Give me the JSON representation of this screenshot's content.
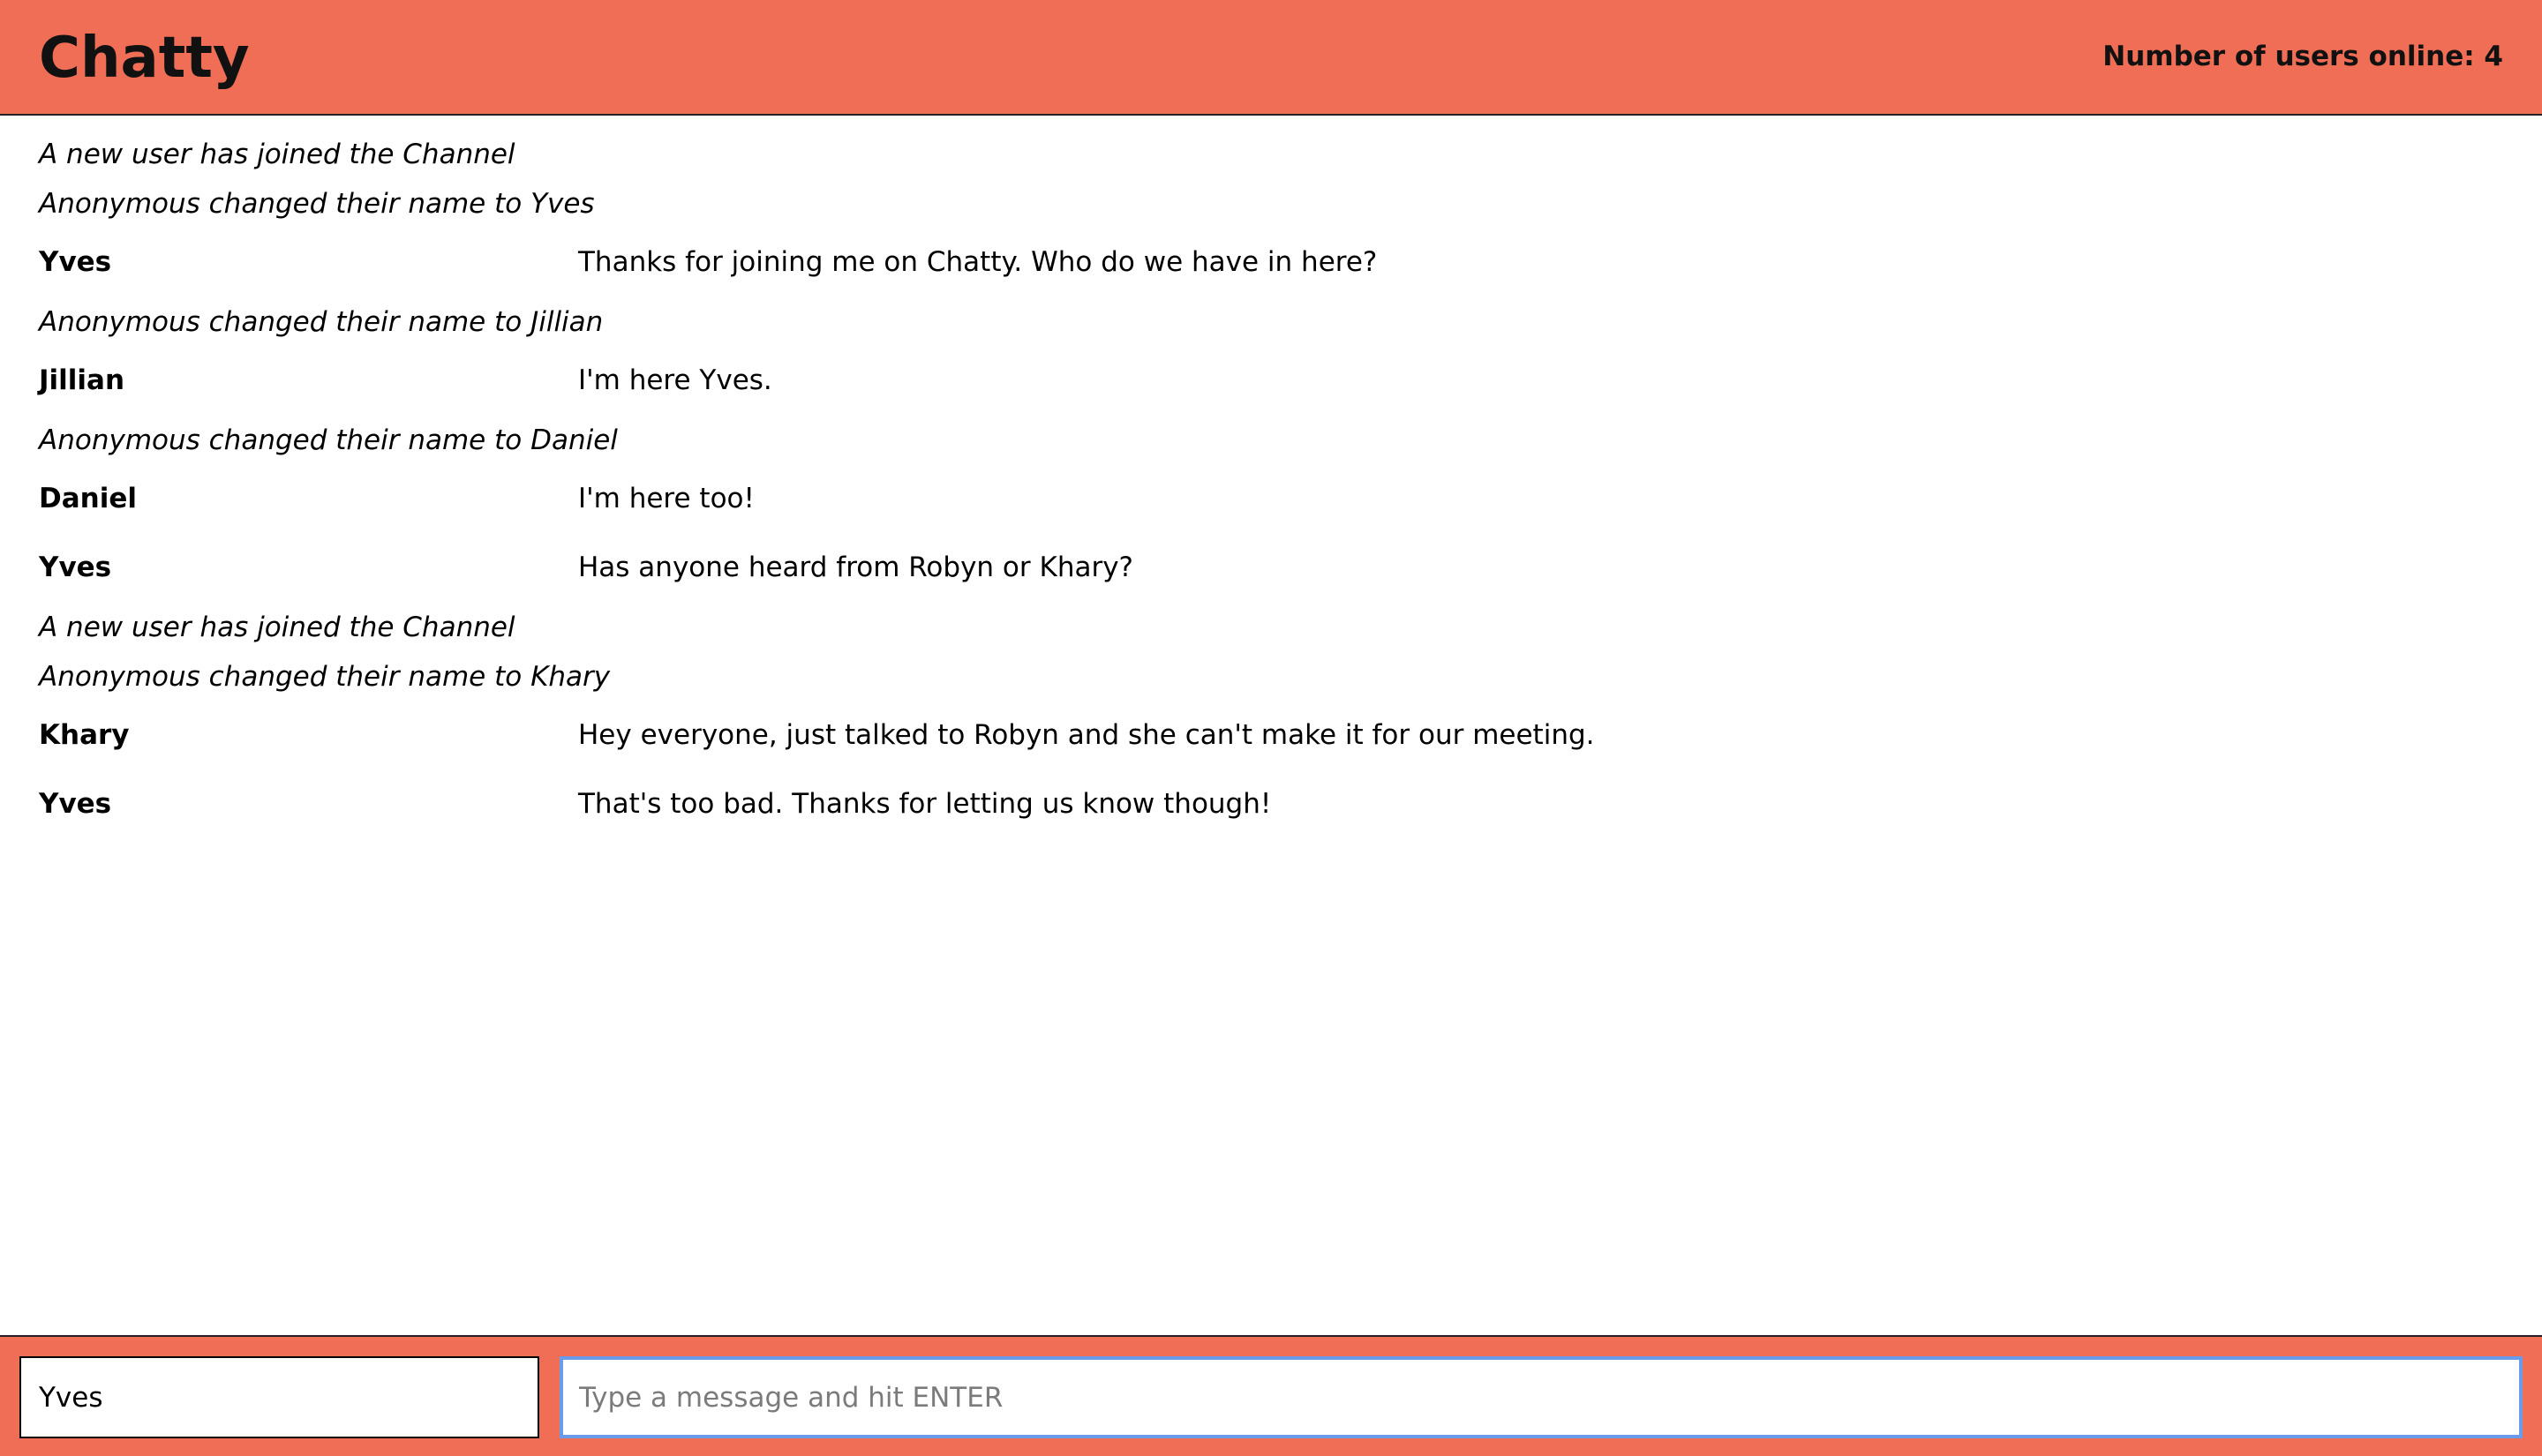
{
  "header": {
    "brand": "Chatty",
    "users_online_text": "Number of users online: 4"
  },
  "messages": [
    {
      "type": "system",
      "text": "A new user has joined the Channel"
    },
    {
      "type": "system",
      "text": "Anonymous changed their name to Yves"
    },
    {
      "type": "chat",
      "username": "Yves",
      "content": "Thanks for joining me on Chatty. Who do we have in here?"
    },
    {
      "type": "system",
      "text": "Anonymous changed their name to Jillian"
    },
    {
      "type": "chat",
      "username": "Jillian",
      "content": "I'm here Yves."
    },
    {
      "type": "system",
      "text": "Anonymous changed their name to Daniel"
    },
    {
      "type": "chat",
      "username": "Daniel",
      "content": "I'm here too!"
    },
    {
      "type": "chat",
      "username": "Yves",
      "content": "Has anyone heard from Robyn or Khary?"
    },
    {
      "type": "system",
      "text": "A new user has joined the Channel"
    },
    {
      "type": "system",
      "text": "Anonymous changed their name to Khary"
    },
    {
      "type": "chat",
      "username": "Khary",
      "content": "Hey everyone, just talked to Robyn and she can't make it for our meeting."
    },
    {
      "type": "chat",
      "username": "Yves",
      "content": "That's too bad. Thanks for letting us know though!"
    }
  ],
  "chatbar": {
    "username_value": "Yves",
    "message_value": "",
    "message_placeholder": "Type a message and hit ENTER"
  },
  "colors": {
    "accent": "#EF6E55",
    "focus_border": "#6A9BEA",
    "text": "#000000"
  }
}
